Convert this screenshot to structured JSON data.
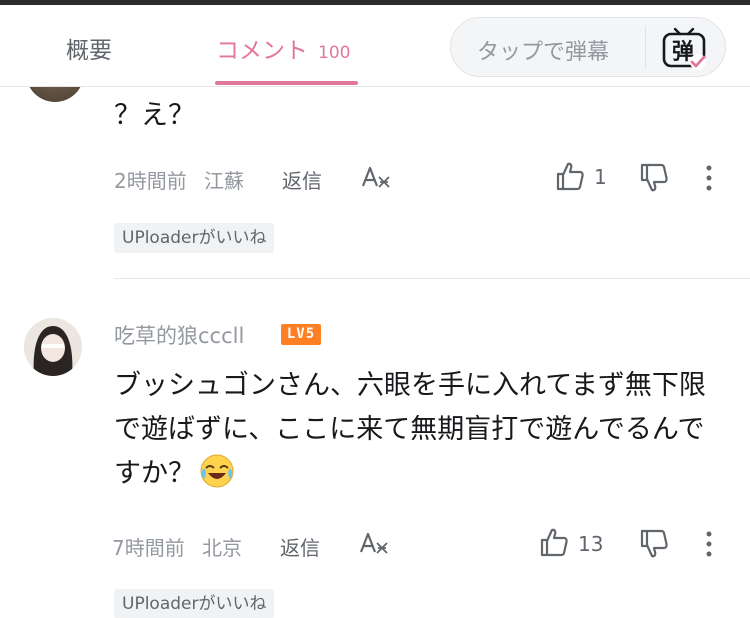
{
  "tabs": {
    "intro_label": "概要",
    "comments_label": "コメント",
    "comments_count": "100"
  },
  "danmaku": {
    "placeholder": "タップで弾幕",
    "icon_char": "弹",
    "icon": "danmaku-toggle-icon"
  },
  "colors": {
    "accent_pink": "#e2779e",
    "level_badge": "#ff7f24",
    "meta_gray": "#9499a0"
  },
  "comments": [
    {
      "text": "？え？",
      "time": "2時間前",
      "location": "江蘇",
      "reply_label": "返信",
      "likes": "1",
      "badge": "UPloaderがいいね"
    },
    {
      "username": "吃草的狼cccll",
      "level": "LV5",
      "text": "ブッシュゴンさん、六眼を手に入れてまず無下限で遊ばずに、ここに来て無期盲打で遊んでるんですか？",
      "time": "7時間前",
      "location": "北京",
      "reply_label": "返信",
      "likes": "13",
      "badge": "UPloaderがいいね",
      "emoji": "laughing-crying-emoji"
    }
  ]
}
